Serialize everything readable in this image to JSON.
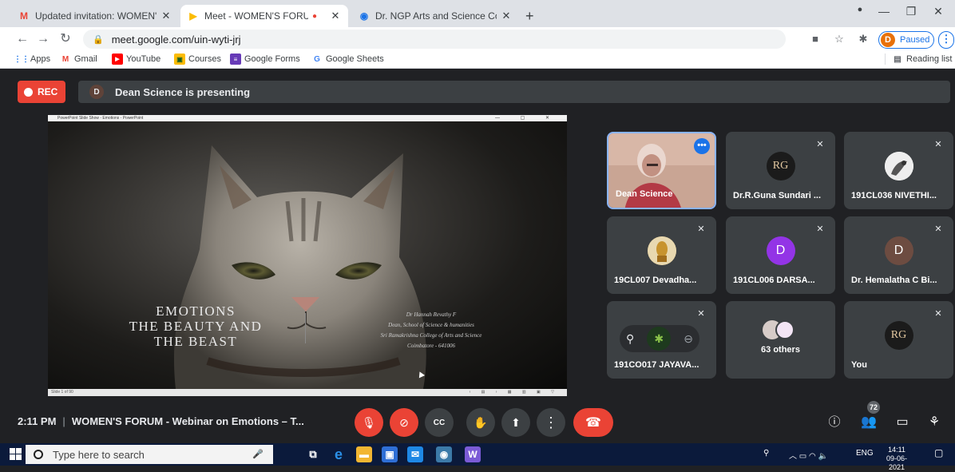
{
  "browser": {
    "tabs": [
      {
        "title": "Updated invitation: WOMEN'S FC",
        "favicon": "gmail-icon",
        "active": false
      },
      {
        "title": "Meet - WOMEN'S FORUM - ",
        "favicon": "meet-icon",
        "active": true
      },
      {
        "title": "Dr. NGP Arts and Science College",
        "favicon": "globe-icon",
        "active": false
      }
    ],
    "url": "meet.google.com/uin-wyti-jrj",
    "profile_initial": "D",
    "profile_status": "Paused",
    "bookmarks": [
      {
        "label": "Apps",
        "icon": "apps-icon",
        "color": "#1a73e8"
      },
      {
        "label": "Gmail",
        "icon": "gmail-icon",
        "color": "#ea4335"
      },
      {
        "label": "YouTube",
        "icon": "youtube-icon",
        "color": "#ff0000"
      },
      {
        "label": "Courses",
        "icon": "courses-icon",
        "color": "#fbbc04"
      },
      {
        "label": "Google Forms",
        "icon": "forms-icon",
        "color": "#673ab7"
      },
      {
        "label": "Google Sheets",
        "icon": "google-icon",
        "color": "#4285f4"
      }
    ],
    "reading_list": "Reading list"
  },
  "meet": {
    "rec_label": "REC",
    "presenter_initial": "D",
    "presenting_text": "Dean Science is presenting",
    "slide": {
      "window_title": "PowerPoint Slide Show  -  Emotions  -  PowerPoint",
      "title_lines": [
        "EMOTIONS",
        "THE BEAUTY AND",
        "THE BEAST"
      ],
      "credit_lines": [
        "Dr Hannah Revathy F",
        "Dean, School of Science & humanities",
        "Sri Ramakrishna College of Arts and Science",
        "Coimbatore - 641006"
      ],
      "status_text": "Slide 1 of 90"
    },
    "tiles": [
      {
        "name": "Dean Science",
        "type": "video",
        "speaking": true
      },
      {
        "name": "Dr.R.Guna Sundari ...",
        "type": "logo",
        "initial": "RG",
        "color": "#1b1b1b"
      },
      {
        "name": "191CL036 NIVETHI...",
        "type": "photo",
        "color": "#f0f0f0"
      },
      {
        "name": "19CL007 Devadha...",
        "type": "photo",
        "color": "#b08a3a"
      },
      {
        "name": "191CL006 DARSA...",
        "type": "initial",
        "initial": "D",
        "color": "#9334e6"
      },
      {
        "name": "Dr. Hemalatha C Bi...",
        "type": "initial",
        "initial": "D",
        "color": "#6d4c41"
      },
      {
        "name": "191CO017 JAYAVA...",
        "type": "hover",
        "color": "#2e7d32"
      },
      {
        "name": "63 others",
        "type": "others",
        "color": "#d7ccc8"
      },
      {
        "name": "You",
        "type": "logo",
        "initial": "RG",
        "color": "#1b1b1b"
      }
    ],
    "meeting_time": "2:11 PM",
    "meeting_title": "WOMEN'S FORUM - Webinar on Emotions – T...",
    "participant_count": "72"
  },
  "taskbar": {
    "search_placeholder": "Type here to search",
    "language": "ENG",
    "time": "14:11",
    "date": "09-06-2021"
  }
}
